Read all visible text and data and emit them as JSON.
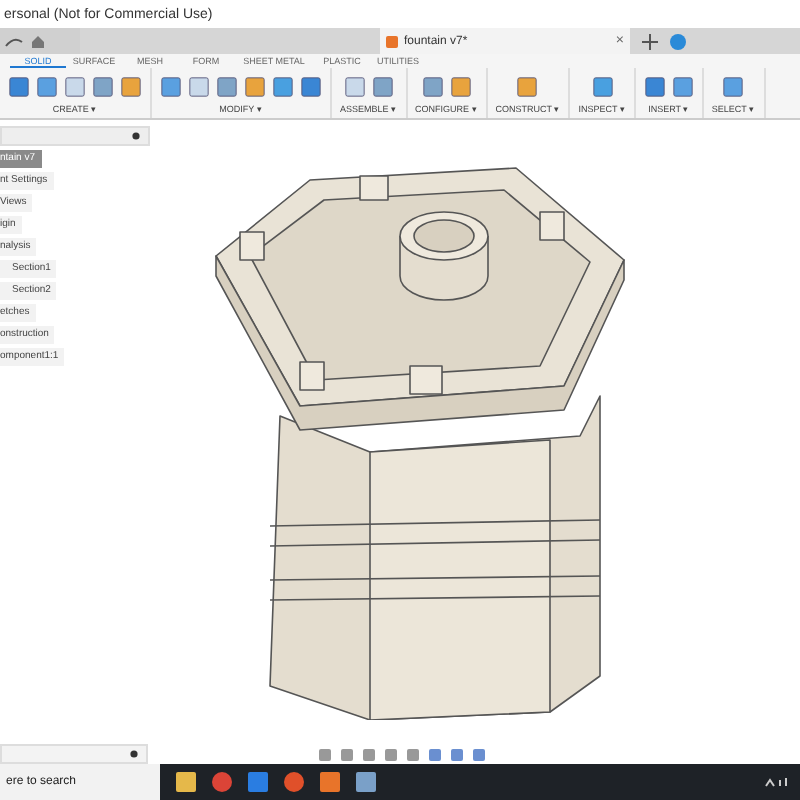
{
  "window": {
    "title": "ersonal (Not for Commercial Use)"
  },
  "document_tab": {
    "title": "fountain v7*",
    "close": "×"
  },
  "toolbar_tabs": [
    {
      "label": "SOLID",
      "selected": true
    },
    {
      "label": "SURFACE",
      "selected": false
    },
    {
      "label": "MESH",
      "selected": false
    },
    {
      "label": "FORM",
      "selected": false
    },
    {
      "label": "SHEET METAL",
      "selected": false
    },
    {
      "label": "PLASTIC",
      "selected": false
    },
    {
      "label": "UTILITIES",
      "selected": false
    }
  ],
  "tool_groups": [
    {
      "label": "CREATE ▾"
    },
    {
      "label": "MODIFY ▾"
    },
    {
      "label": "ASSEMBLE ▾"
    },
    {
      "label": "CONFIGURE ▾"
    },
    {
      "label": "CONSTRUCT ▾"
    },
    {
      "label": "INSPECT ▾"
    },
    {
      "label": "INSERT ▾"
    },
    {
      "label": "SELECT ▾"
    }
  ],
  "browser": {
    "items": [
      {
        "label": "ntain v7",
        "selected": true
      },
      {
        "label": "nt Settings",
        "selected": false
      },
      {
        "label": "Views",
        "selected": false
      },
      {
        "label": "igin",
        "selected": false
      },
      {
        "label": "nalysis",
        "selected": false
      },
      {
        "label": "Section1",
        "selected": false
      },
      {
        "label": "Section2",
        "selected": false
      },
      {
        "label": "etches",
        "selected": false
      },
      {
        "label": "onstruction",
        "selected": false
      },
      {
        "label": "omponent1:1",
        "selected": false
      }
    ]
  },
  "taskbar": {
    "search_placeholder": "ere to search"
  }
}
